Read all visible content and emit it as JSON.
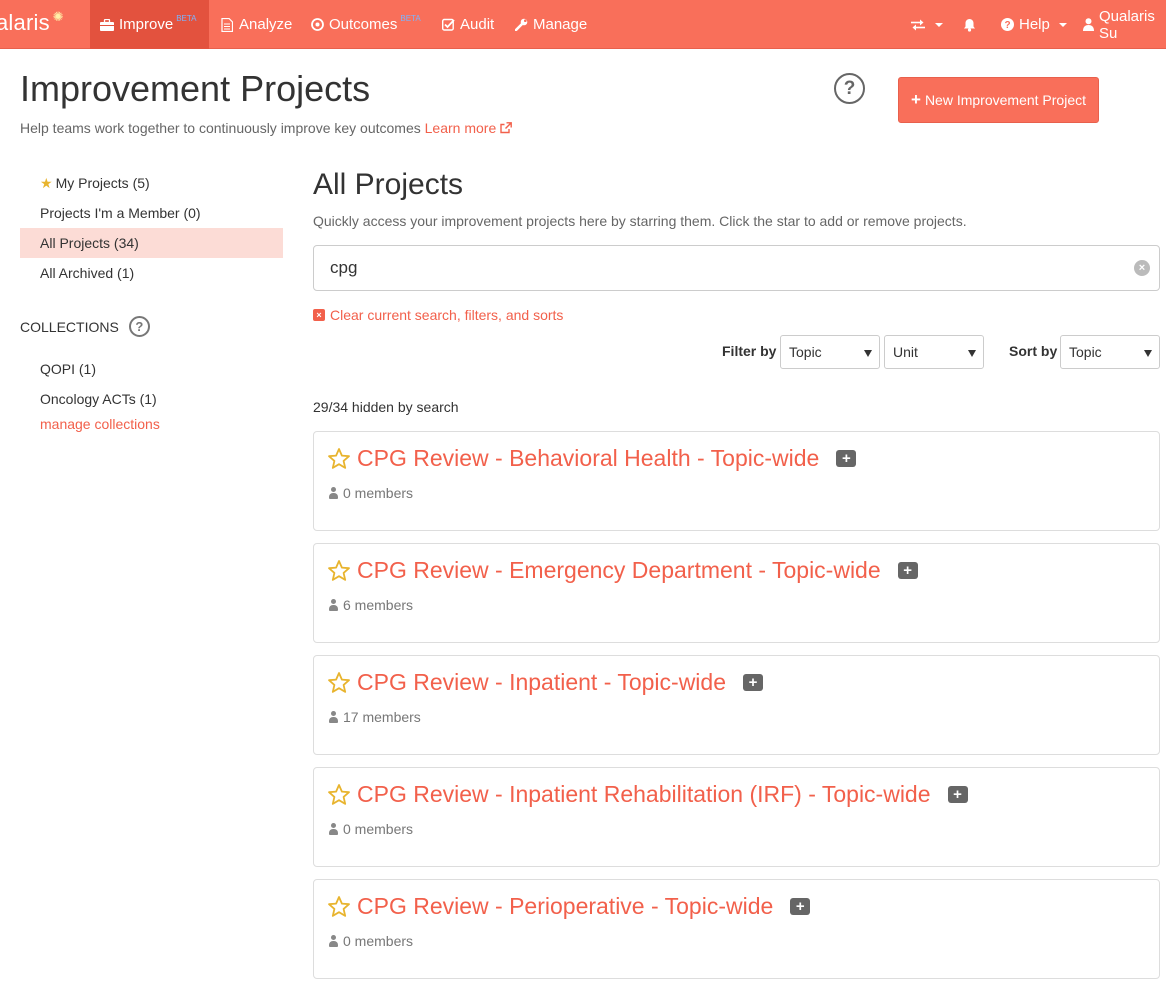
{
  "navbar": {
    "brand": "alaris",
    "items": [
      {
        "label": "Improve",
        "badge": "BETA",
        "icon": "briefcase-icon"
      },
      {
        "label": "Analyze",
        "icon": "document-icon"
      },
      {
        "label": "Outcomes",
        "badge": "BETA",
        "icon": "target-icon"
      },
      {
        "label": "Audit",
        "icon": "check-square-icon"
      },
      {
        "label": "Manage",
        "icon": "wrench-icon"
      }
    ],
    "help_label": "Help",
    "user_label": "Qualaris Su",
    "accent": "#f96f5a"
  },
  "header": {
    "title": "Improvement Projects",
    "subtitle": "Help teams work together to continuously improve key outcomes",
    "learn_more": "Learn more",
    "new_button": "New Improvement Project"
  },
  "sidebar": {
    "items": [
      {
        "label": "My Projects (5)"
      },
      {
        "label": "Projects I'm a Member (0)"
      },
      {
        "label": "All Projects (34)",
        "active": true
      },
      {
        "label": "All Archived (1)"
      }
    ],
    "collections_header": "COLLECTIONS",
    "collections": [
      {
        "label": "QOPI (1)"
      },
      {
        "label": "Oncology ACTs (1)"
      }
    ],
    "manage_link": "manage collections"
  },
  "main": {
    "title": "All Projects",
    "subtitle": "Quickly access your improvement projects here by starring them. Click the star to add or remove projects.",
    "search_value": "cpg",
    "clear_link": "Clear current search, filters, and sorts",
    "filter_label": "Filter by",
    "filter_topic": "Topic",
    "filter_unit": "Unit",
    "sort_label": "Sort by",
    "sort_value": "Topic",
    "hidden_count": "29/34 hidden by search",
    "projects": [
      {
        "title": "CPG Review - Behavioral Health - Topic-wide",
        "members": "0 members"
      },
      {
        "title": "CPG Review - Emergency Department - Topic-wide",
        "members": "6 members"
      },
      {
        "title": "CPG Review - Inpatient - Topic-wide",
        "members": "17 members"
      },
      {
        "title": "CPG Review - Inpatient Rehabilitation (IRF) - Topic-wide",
        "members": "0 members"
      },
      {
        "title": "CPG Review - Perioperative - Topic-wide",
        "members": "0 members"
      }
    ]
  }
}
